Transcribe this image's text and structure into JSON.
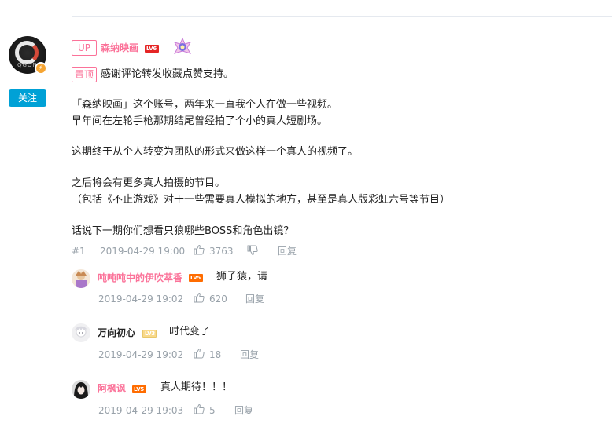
{
  "main_comment": {
    "up_tag": "UP",
    "author": "森纳映画",
    "level": "LV6",
    "pin_tag": "置顶",
    "pin_text": "感谢评论转发收藏点赞支持。",
    "follow_label": "关注",
    "avatar_text": "QGON",
    "lines": [
      "「森纳映画」这个账号，两年来一直我个人在做一些视频。",
      "早年间在左轮手枪那期结尾曾经拍了个小的真人短剧场。",
      "这期终于从个人转变为团队的形式来做这样一个真人的视频了。",
      "之后将会有更多真人拍摄的节目。",
      "（包括《不止游戏》对于一些需要真人模拟的地方，甚至是真人版彩虹六号等节目）",
      "话说下一期你们想看只狼哪些BOSS和角色出镜？"
    ],
    "floor": "#1",
    "time": "2019-04-29 19:00",
    "likes": "3763",
    "reply_label": "回复"
  },
  "replies": [
    {
      "author": "吨吨吨中的伊吹萃香",
      "level": "LV5",
      "text": "狮子猿，请",
      "time": "2019-04-29 19:02",
      "likes": "620",
      "reply_label": "回复",
      "name_color": "#fb7299"
    },
    {
      "author": "万向初心",
      "level": "LV3",
      "text": "时代变了",
      "time": "2019-04-29 19:02",
      "likes": "18",
      "reply_label": "回复",
      "name_color": "#222222"
    },
    {
      "author": "阿枫讽",
      "level": "LV5",
      "text": "真人期待！！！",
      "time": "2019-04-29 19:03",
      "likes": "5",
      "reply_label": "回复",
      "name_color": "#fb7299"
    }
  ],
  "colors": {
    "accent_pink": "#fb7299",
    "follow_blue": "#00a1d6",
    "meta_gray": "#99a2aa"
  }
}
